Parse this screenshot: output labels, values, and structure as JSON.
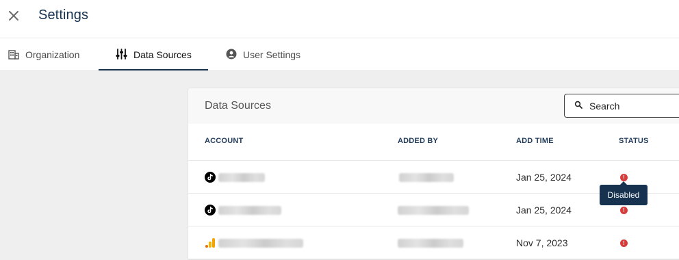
{
  "header": {
    "title": "Settings",
    "close_icon": "close-icon"
  },
  "tabs": [
    {
      "label": "Organization",
      "icon": "building-icon",
      "active": false
    },
    {
      "label": "Data Sources",
      "icon": "sliders-icon",
      "active": true
    },
    {
      "label": "User Settings",
      "icon": "user-circle-icon",
      "active": false
    }
  ],
  "card": {
    "title": "Data Sources",
    "search": {
      "placeholder": "Search",
      "value": ""
    }
  },
  "table": {
    "columns": [
      "ACCOUNT",
      "ADDED BY",
      "ADD TIME",
      "STATUS"
    ],
    "rows": [
      {
        "account_icon": "tiktok-icon",
        "add_time": "Jan 25, 2024",
        "status_icon": "error-icon"
      },
      {
        "account_icon": "tiktok-icon",
        "add_time": "Jan 25, 2024",
        "status_icon": "error-icon"
      },
      {
        "account_icon": "google-analytics-icon",
        "add_time": "Nov 7, 2023",
        "status_icon": "error-icon"
      }
    ]
  },
  "tooltip": {
    "text": "Disabled"
  },
  "colors": {
    "primary_navy": "#16324f",
    "status_error": "#d93b3b",
    "analytics_orange": "#f4a300"
  }
}
